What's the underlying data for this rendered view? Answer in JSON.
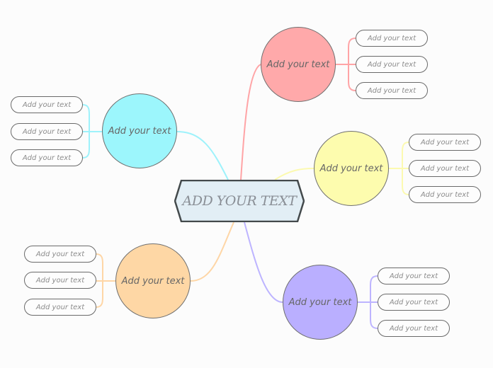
{
  "central": {
    "label": "Add your text",
    "fill": "#e2eef5",
    "stroke": "#444a4c"
  },
  "branches": [
    {
      "id": "red",
      "label": "Add your text",
      "color": "#ffa9aa",
      "line": "#ffa4a6",
      "children": [
        "Add your text",
        "Add your text",
        "Add your text"
      ]
    },
    {
      "id": "cyan",
      "label": "Add your text",
      "color": "#9cf6fc",
      "line": "#9ef2fb",
      "children": [
        "Add your text",
        "Add your text",
        "Add your text"
      ]
    },
    {
      "id": "yellow",
      "label": "Add your text",
      "color": "#fdfcae",
      "line": "#fcfab0",
      "children": [
        "Add your text",
        "Add your text",
        "Add your text"
      ]
    },
    {
      "id": "orange",
      "label": "Add your text",
      "color": "#fed7a5",
      "line": "#fed6a6",
      "children": [
        "Add your text",
        "Add your text",
        "Add your text"
      ]
    },
    {
      "id": "purple",
      "label": "Add your text",
      "color": "#baafff",
      "line": "#bdb4ff",
      "children": [
        "Add your text",
        "Add your text",
        "Add your text"
      ]
    }
  ]
}
